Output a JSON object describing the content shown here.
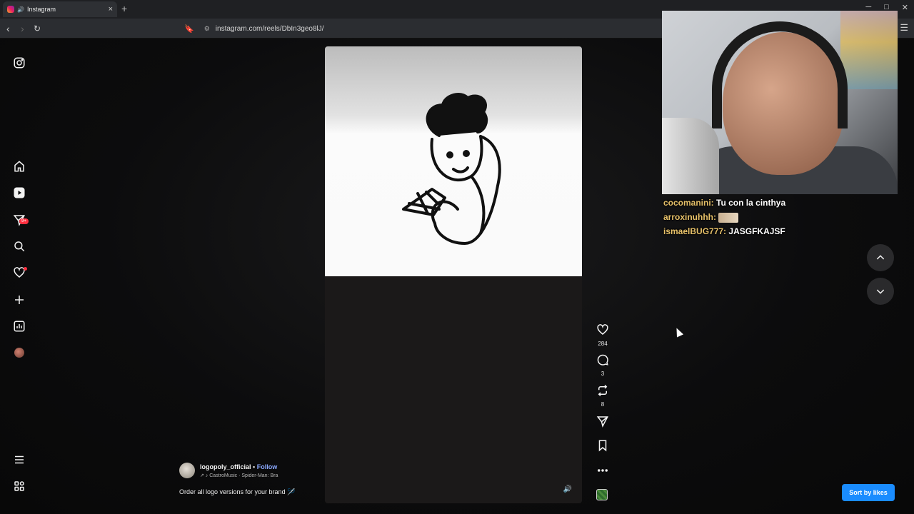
{
  "browser": {
    "tab_title": "Instagram",
    "tab_close": "×",
    "new_tab": "+",
    "url": "instagram.com/reels/DbIn3geo8lJ/",
    "window_controls": [
      "─",
      "□",
      "✕"
    ]
  },
  "sidebar": {
    "notification_badge": "9+",
    "icons": [
      "instagram-icon",
      "home-icon",
      "reels-icon",
      "messages-icon",
      "search-icon",
      "notifications-icon",
      "create-icon",
      "dashboard-icon",
      "profile-icon",
      "menu-icon",
      "more-icon"
    ]
  },
  "reel": {
    "author": "logopoly_official",
    "separator": "•",
    "follow_label": "Follow",
    "music": "↗ ♪ CastroMusic · Spider-Man: Bra",
    "caption": "Order all logo versions for your brand 🪡",
    "likes": "284",
    "comments": "3",
    "reposts": "8"
  },
  "chat": [
    {
      "user": "cocomanini:",
      "message": "Tu con la cinthya",
      "emote": false
    },
    {
      "user": "arroxinuhhh:",
      "message": "",
      "emote": true
    },
    {
      "user": "ismaelBUG777:",
      "message": "JASGFKAJSF",
      "emote": false
    }
  ],
  "sort_button": "Sort by likes",
  "colors": {
    "accent_blue": "#1a8cff",
    "chat_user": "#e8c26a",
    "badge_red": "#ff3040"
  }
}
